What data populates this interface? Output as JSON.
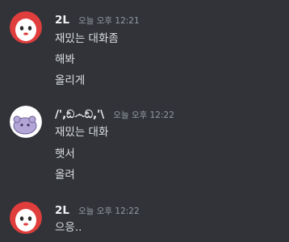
{
  "messages": [
    {
      "username": "2L",
      "timestamp": "오늘 오후 12:21",
      "avatar_icon": "red-white-ghost-avatar",
      "lines": [
        "재밌는 대화좀",
        "해봐",
        "올리게"
      ]
    },
    {
      "username": "/',ඞ෴ඞ,'\\",
      "timestamp": "오늘 오후 12:22",
      "avatar_icon": "purple-blob-avatar",
      "lines": [
        "재밌는 대화",
        "햇서",
        "올려"
      ]
    },
    {
      "username": "2L",
      "timestamp": "오늘 오후 12:22",
      "avatar_icon": "red-white-ghost-avatar",
      "lines": [
        "으응.."
      ]
    }
  ],
  "colors": {
    "background": "#313338",
    "username": "#f2f3f5",
    "timestamp": "#949ba4",
    "message_text": "#dbdee1"
  }
}
